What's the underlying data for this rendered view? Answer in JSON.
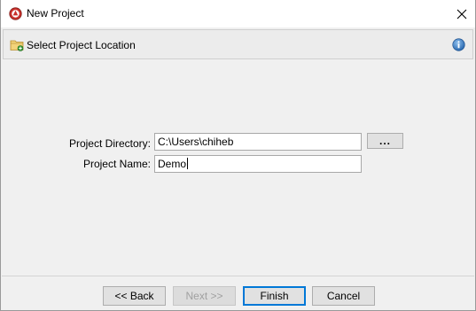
{
  "window": {
    "title": "New Project"
  },
  "header": {
    "title": "Select Project Location"
  },
  "form": {
    "directory_label": "Project Directory:",
    "directory_value": "C:\\Users\\chiheb",
    "name_label": "Project Name:",
    "name_value": "Demo",
    "browse_label": "..."
  },
  "buttons": {
    "back": "<< Back",
    "next": "Next >>",
    "finish": "Finish",
    "cancel": "Cancel"
  },
  "colors": {
    "accent": "#0078d7",
    "app_icon": "#c0392b",
    "info_icon": "#2f6fb5"
  }
}
